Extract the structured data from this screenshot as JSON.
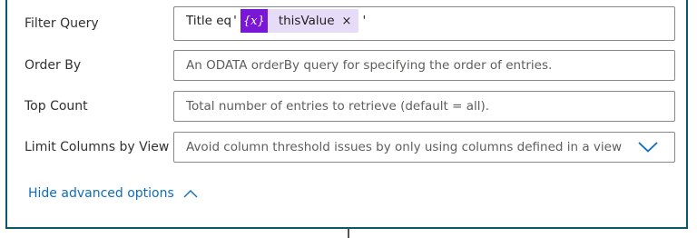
{
  "fields": {
    "filter_query": {
      "label": "Filter Query",
      "prefix_text": "Title eq",
      "open_quote": "'",
      "token": {
        "icon": "{x}",
        "label": "thisValue",
        "remove": "×"
      },
      "close_quote": "'"
    },
    "order_by": {
      "label": "Order By",
      "placeholder": "An ODATA orderBy query for specifying the order of entries."
    },
    "top_count": {
      "label": "Top Count",
      "placeholder": "Total number of entries to retrieve (default = all)."
    },
    "limit_columns": {
      "label": "Limit Columns by View",
      "placeholder": "Avoid column threshold issues by only using columns defined in a view"
    }
  },
  "advanced": {
    "toggle_label": "Hide advanced options"
  },
  "icons": {
    "dropdown": "chevron-down-icon",
    "toggle": "chevron-up-icon",
    "token": "expression-variable-icon",
    "remove": "close-icon"
  },
  "colors": {
    "card_border": "#0a5a6a",
    "token_icon_bg": "#7a16d6",
    "token_bg": "#e7dcf7",
    "link": "#0f6cbd",
    "chevron": "#0f6cbd"
  }
}
